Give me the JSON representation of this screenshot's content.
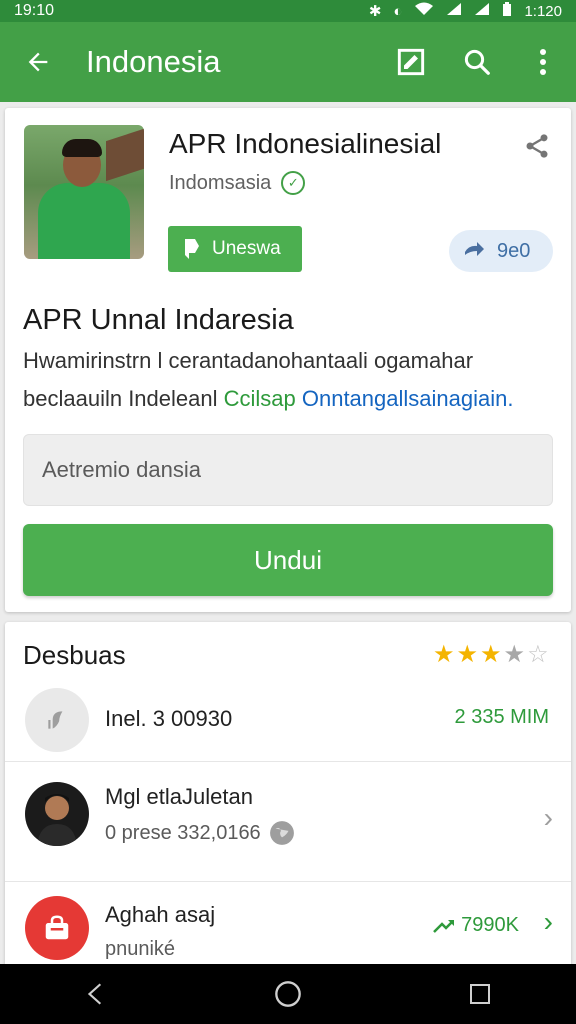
{
  "status_bar": {
    "time": "19:10",
    "right_time": "1:120",
    "icons": [
      "bluetooth-icon",
      "data-saver-icon",
      "wifi-icon",
      "signal-icon",
      "signal-icon",
      "battery-icon"
    ]
  },
  "app_bar": {
    "title": "Indonesia",
    "actions": [
      "edit-icon",
      "search-icon",
      "more-vert-icon"
    ],
    "color": "#43a047"
  },
  "app_card": {
    "name": "APR Indonesialinesial",
    "publisher": "Indomsasia",
    "green_chip_label": "Uneswa",
    "right_chip_label": "9e0",
    "heading": "APR Unnal Indaresia",
    "desc_line1": "Hwamirinstrn l cerantadanohantaali ogamahar",
    "desc_line2_plain": "beclaauiln Indeleanl ",
    "desc_line2_green": "Ccilsap",
    "desc_line2_blue": " Onntangallsainagiain.",
    "field_value": "Aetremio dansia",
    "install_label": "Undui"
  },
  "details_card": {
    "title": "Desbuas",
    "rating": 3.5,
    "rows": [
      {
        "text": "Inel. 3 00930",
        "value": "2 335 MIM"
      },
      {
        "text": "Mgl etlaJuletan",
        "sub": "0 prese 332,0166"
      },
      {
        "text": "Aghah asaj",
        "sub": "pnuniké",
        "value": "7990K"
      }
    ]
  },
  "colors": {
    "accent": "#4caf50",
    "status_bar": "#2e8b3a",
    "link_blue": "#1565c0",
    "star": "#f4b400"
  }
}
